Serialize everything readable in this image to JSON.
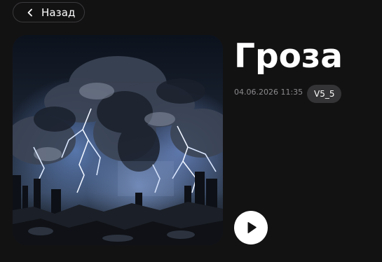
{
  "header": {
    "back_label": "Назад",
    "back_icon": "chevron-left-icon"
  },
  "track": {
    "title": "Гроза",
    "date": "04.06.2026 11:35",
    "version": "V5_5",
    "cover_description_icon": "storm-cover-image",
    "play_icon": "play-icon"
  },
  "colors": {
    "background": "#131213",
    "badge_bg": "#343335",
    "muted_text": "#8b8a8c",
    "accent": "#ffffff"
  }
}
